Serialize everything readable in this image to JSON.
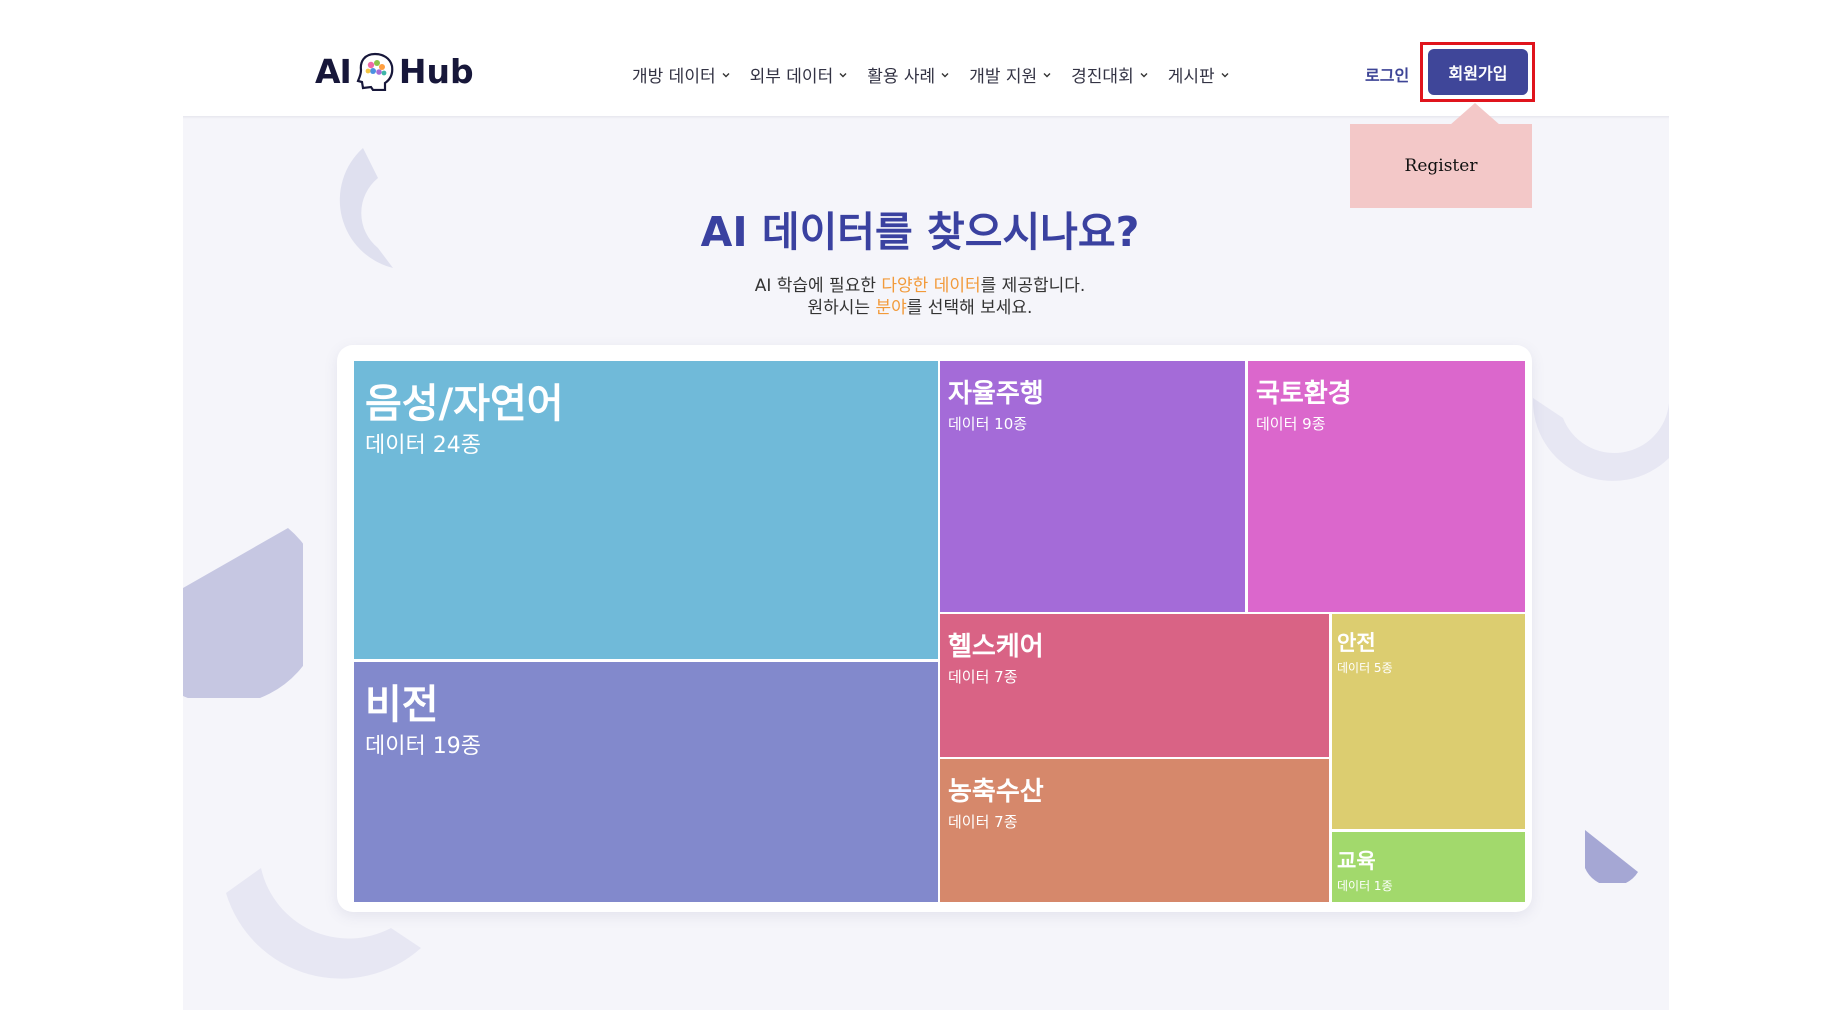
{
  "header": {
    "logo_left": "AI",
    "logo_right": "Hub",
    "nav": [
      "개방 데이터",
      "외부 데이터",
      "활용 사례",
      "개발 지원",
      "경진대회",
      "게시판"
    ],
    "login": "로그인",
    "signup": "회원가입"
  },
  "callout": {
    "text": "Register"
  },
  "hero": {
    "title": "AI 데이터를 찾으시나요?",
    "line1_before": "AI 학습에 필요한 ",
    "line1_highlight": "다양한 데이터",
    "line1_after": "를 제공합니다.",
    "line2_before": "원하시는 ",
    "line2_highlight": "분야",
    "line2_after": "를 선택해 보세요.",
    "highlight_color": "#f29a3a"
  },
  "categories": [
    {
      "name": "음성/자연어",
      "count": "데이터 24종",
      "color": "#70bad9"
    },
    {
      "name": "비전",
      "count": "데이터 19종",
      "color": "#8289cc"
    },
    {
      "name": "자율주행",
      "count": "데이터 10종",
      "color": "#a46bd8"
    },
    {
      "name": "국토환경",
      "count": "데이터 9종",
      "color": "#db67cc"
    },
    {
      "name": "헬스케어",
      "count": "데이터 7종",
      "color": "#d96385"
    },
    {
      "name": "농축수산",
      "count": "데이터 7종",
      "color": "#d6886b"
    },
    {
      "name": "안전",
      "count": "데이터 5종",
      "color": "#dccd70"
    },
    {
      "name": "교육",
      "count": "데이터 1종",
      "color": "#a2d96c"
    }
  ]
}
